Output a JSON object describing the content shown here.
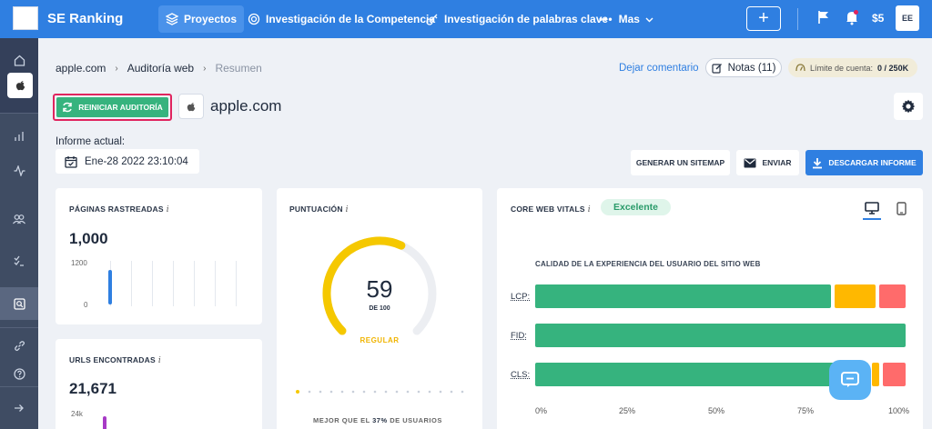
{
  "topbar": {
    "brand": "SE Ranking",
    "nav": [
      "Proyectos",
      "Investigación de la Competencia",
      "Investigación de palabras clave",
      "Mas"
    ],
    "balance": "$5",
    "avatar": "EE"
  },
  "breadcrumb": [
    "apple.com",
    "Auditoría web",
    "Resumen"
  ],
  "header_actions": {
    "comment": "Dejar comentario",
    "notes": "Notas (11)",
    "limit_label": "Límite de cuenta:",
    "limit_value": "0 / 250K"
  },
  "audit": {
    "restart": "REINICIAR AUDITORÍA",
    "site": "apple.com",
    "report_label": "Informe actual:",
    "report_date": "Ene-28 2022 23:10:04"
  },
  "actions": {
    "sitemap": "GENERAR UN SITEMAP",
    "send": "ENVIAR",
    "download": "DESCARGAR INFORME"
  },
  "pages_card": {
    "title": "PÁGINAS RASTREADAS",
    "value": "1,000",
    "ymax": "1200",
    "ymin": "0",
    "bar_fraction": 0.31
  },
  "urls_card": {
    "title": "URLS ENCONTRADAS",
    "value": "21,671",
    "ymax": "24k"
  },
  "score_card": {
    "title": "PUNTUACIÓN",
    "score": "59",
    "of": "DE 100",
    "rating": "REGULAR",
    "better_prefix": "MEJOR QUE EL",
    "better_pct": "37%",
    "better_suffix": "DE USUARIOS",
    "score_fraction": 0.59
  },
  "cwv_card": {
    "title": "CORE WEB VITALS",
    "badge": "Excelente",
    "subtitle": "CALIDAD DE LA EXPERIENCIA DEL USUARIO DEL SITIO WEB",
    "metrics": [
      {
        "label": "LCP:",
        "good": 80,
        "mid": 12,
        "poor": 8
      },
      {
        "label": "FID:",
        "good": 100,
        "mid": 0,
        "poor": 0
      },
      {
        "label": "CLS:",
        "good": 90,
        "mid": 3,
        "poor": 7
      }
    ],
    "axis": [
      "0%",
      "25%",
      "50%",
      "75%",
      "100%"
    ]
  },
  "colors": {
    "brand": "#2f7fe1",
    "good": "#36b37e",
    "mid": "#ffb800",
    "poor": "#ff6b6b",
    "gauge": "#f5c800"
  }
}
